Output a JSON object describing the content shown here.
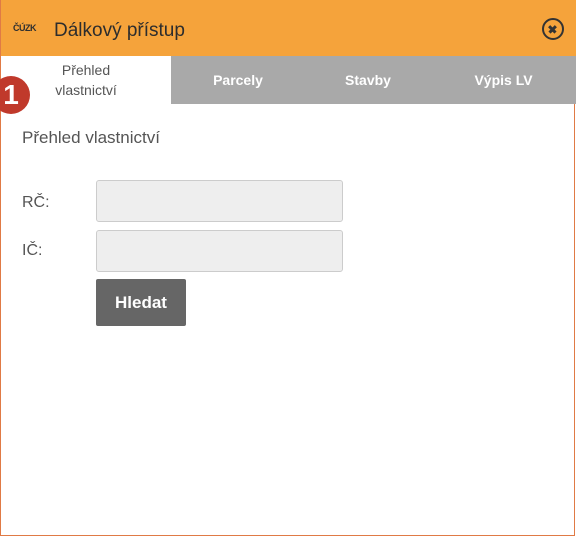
{
  "window": {
    "logo_text": "ČÚZK",
    "title": "Dálkový přístup",
    "close_icon": "close-circle-icon"
  },
  "tabs": [
    {
      "label": "Přehled vlastnictví",
      "active": true
    },
    {
      "label": "Parcely",
      "active": false
    },
    {
      "label": "Stavby",
      "active": false
    },
    {
      "label": "Výpis LV",
      "active": false
    }
  ],
  "badge": {
    "number": "1",
    "color": "#c0392b"
  },
  "form": {
    "section_title": "Přehled vlastnictví",
    "rc_label": "RČ:",
    "rc_value": "",
    "ic_label": "IČ:",
    "ic_value": "",
    "search_label": "Hledat"
  },
  "colors": {
    "titlebar": "#f5a33b",
    "tabbar": "#a9a9a9",
    "button": "#666666"
  }
}
